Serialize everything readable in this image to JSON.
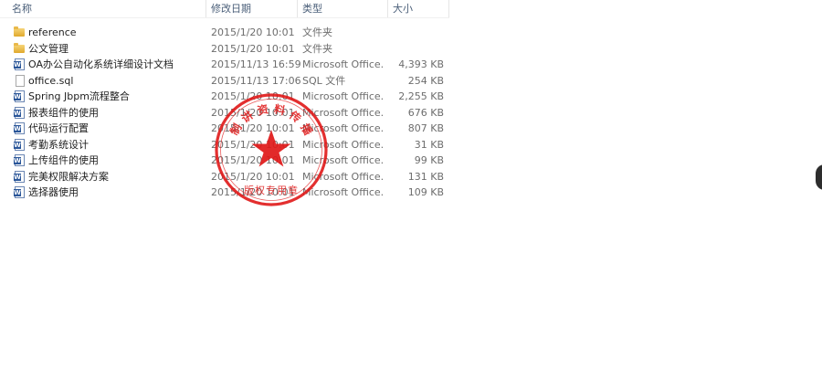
{
  "columns": {
    "name": "名称",
    "date": "修改日期",
    "type": "类型",
    "size": "大小"
  },
  "files": [
    {
      "icon": "folder-icon",
      "name": "reference",
      "date": "2015/1/20 10:01",
      "type": "文件夹",
      "size": ""
    },
    {
      "icon": "folder-icon",
      "name": "公文管理",
      "date": "2015/1/20 10:01",
      "type": "文件夹",
      "size": ""
    },
    {
      "icon": "word-document-icon",
      "name": "OA办公自动化系统详细设计文档",
      "date": "2015/11/13 16:59",
      "type": "Microsoft Office...",
      "size": "4,393 KB"
    },
    {
      "icon": "sql-file-icon",
      "name": "office.sql",
      "date": "2015/11/13 17:06",
      "type": "SQL 文件",
      "size": "254 KB"
    },
    {
      "icon": "word-document-icon",
      "name": "Spring Jbpm流程整合",
      "date": "2015/1/20 10:01",
      "type": "Microsoft Office...",
      "size": "2,255 KB"
    },
    {
      "icon": "word-document-icon",
      "name": "报表组件的使用",
      "date": "2015/1/20 10:01",
      "type": "Microsoft Office...",
      "size": "676 KB"
    },
    {
      "icon": "word-document-icon",
      "name": "代码运行配置",
      "date": "2015/1/20 10:01",
      "type": "Microsoft Office...",
      "size": "807 KB"
    },
    {
      "icon": "word-document-icon",
      "name": "考勤系统设计",
      "date": "2015/1/20 10:01",
      "type": "Microsoft Office...",
      "size": "31 KB"
    },
    {
      "icon": "word-document-icon",
      "name": "上传组件的使用",
      "date": "2015/1/20 10:01",
      "type": "Microsoft Office...",
      "size": "99 KB"
    },
    {
      "icon": "word-document-icon",
      "name": "完美权限解决方案",
      "date": "2015/1/20 10:01",
      "type": "Microsoft Office...",
      "size": "131 KB"
    },
    {
      "icon": "word-document-icon",
      "name": "选择器使用",
      "date": "2015/1/20 10:01",
      "type": "Microsoft Office...",
      "size": "109 KB"
    }
  ],
  "stamp": {
    "arc_text": "制讲资料传播",
    "center_text": "版权专用章",
    "color": "#e01818"
  },
  "colors": {
    "header_text": "#4c607a",
    "secondary_text": "#6d6d6d",
    "primary_text": "#1e1e1e",
    "folder": "#e9b94a",
    "word": "#2a5699"
  }
}
